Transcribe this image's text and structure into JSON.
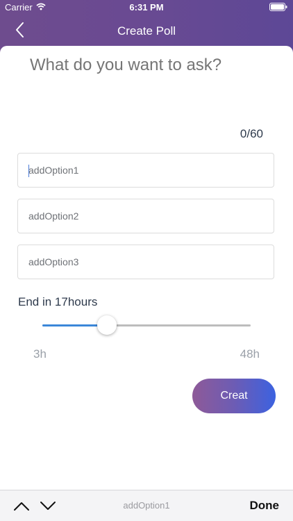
{
  "status_bar": {
    "carrier": "Carrier",
    "time": "6:31 PM"
  },
  "header": {
    "title": "Create Poll"
  },
  "question": {
    "placeholder": "What do you want to ask?",
    "counter": "0/60"
  },
  "options": [
    {
      "placeholder": "addOption1"
    },
    {
      "placeholder": "addOption2"
    },
    {
      "placeholder": "addOption3"
    }
  ],
  "duration": {
    "label": "End in 17hours",
    "min_label": "3h",
    "max_label": "48h",
    "min": 3,
    "max": 48,
    "value": 17
  },
  "create_button": {
    "label": "Creat"
  },
  "keyboard_toolbar": {
    "field_name": "addOption1",
    "done_label": "Done"
  },
  "colors": {
    "header_gradient_start": "#6e4c8e",
    "header_gradient_end": "#5d4896",
    "button_gradient_start": "#8e5a98",
    "button_gradient_end": "#3c62e0",
    "slider_fill": "#3b87d9"
  }
}
